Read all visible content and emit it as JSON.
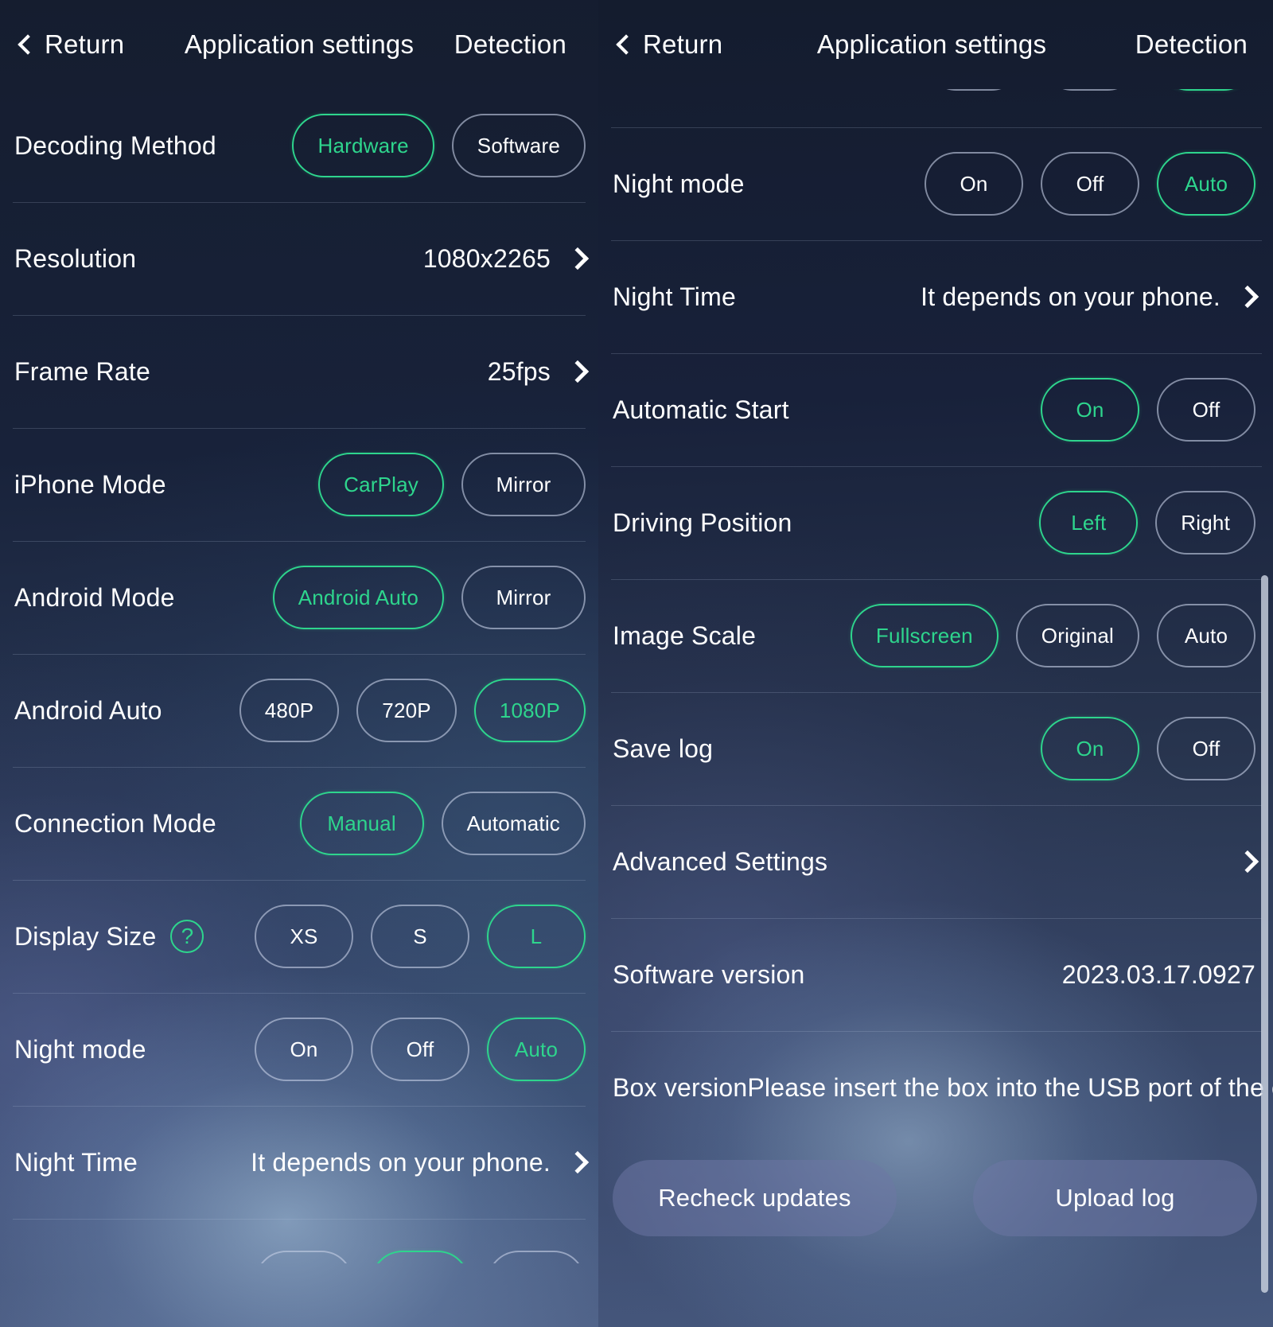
{
  "header": {
    "back_label": "Return",
    "title": "Application settings",
    "detection_label": "Detection"
  },
  "left_panel": {
    "rows": [
      {
        "label": "Decoding Method",
        "type": "pills",
        "options": [
          "Hardware",
          "Software"
        ],
        "selected": "Hardware"
      },
      {
        "label": "Resolution",
        "type": "value",
        "value": "1080x2265"
      },
      {
        "label": "Frame Rate",
        "type": "value",
        "value": "25fps"
      },
      {
        "label": "iPhone Mode",
        "type": "pills",
        "options": [
          "CarPlay",
          "Mirror"
        ],
        "selected": "CarPlay"
      },
      {
        "label": "Android Mode",
        "type": "pills",
        "options": [
          "Android Auto",
          "Mirror"
        ],
        "selected": "Android Auto"
      },
      {
        "label": "Android Auto",
        "type": "pills",
        "options": [
          "480P",
          "720P",
          "1080P"
        ],
        "selected": "1080P"
      },
      {
        "label": "Connection Mode",
        "type": "pills",
        "options": [
          "Manual",
          "Automatic"
        ],
        "selected": "Manual"
      },
      {
        "label": "Display Size",
        "type": "pills",
        "help_icon": "?",
        "options": [
          "XS",
          "S",
          "L"
        ],
        "selected": "L"
      },
      {
        "label": "Night mode",
        "type": "pills",
        "options": [
          "On",
          "Off",
          "Auto"
        ],
        "selected": "Auto"
      },
      {
        "label": "Night Time",
        "type": "value",
        "value": "It depends on your phone."
      }
    ]
  },
  "right_panel": {
    "rows": [
      {
        "label": "Night mode",
        "type": "pills",
        "options": [
          "On",
          "Off",
          "Auto"
        ],
        "selected": "Auto"
      },
      {
        "label": "Night Time",
        "type": "value",
        "value": "It depends on your phone."
      },
      {
        "label": "Automatic Start",
        "type": "pills",
        "options": [
          "On",
          "Off"
        ],
        "selected": "On"
      },
      {
        "label": "Driving Position",
        "type": "pills",
        "options": [
          "Left",
          "Right"
        ],
        "selected": "Left"
      },
      {
        "label": "Image Scale",
        "type": "pills",
        "options": [
          "Fullscreen",
          "Original",
          "Auto"
        ],
        "selected": "Fullscreen"
      },
      {
        "label": "Save log",
        "type": "pills",
        "options": [
          "On",
          "Off"
        ],
        "selected": "On"
      },
      {
        "label": "Advanced Settings",
        "type": "nav"
      },
      {
        "label": "Software version",
        "type": "value",
        "value": "2023.03.17.0927"
      },
      {
        "label": "Box version",
        "type": "value",
        "value": "Please insert the box into the USB port of the car"
      }
    ],
    "actions": {
      "recheck_label": "Recheck updates",
      "upload_label": "Upload log"
    }
  },
  "colors": {
    "accent_green": "#2ed58d",
    "pill_border": "#c4cde4",
    "text": "#ffffff",
    "background_top": "#141d30",
    "background_bottom": "#51648a"
  }
}
